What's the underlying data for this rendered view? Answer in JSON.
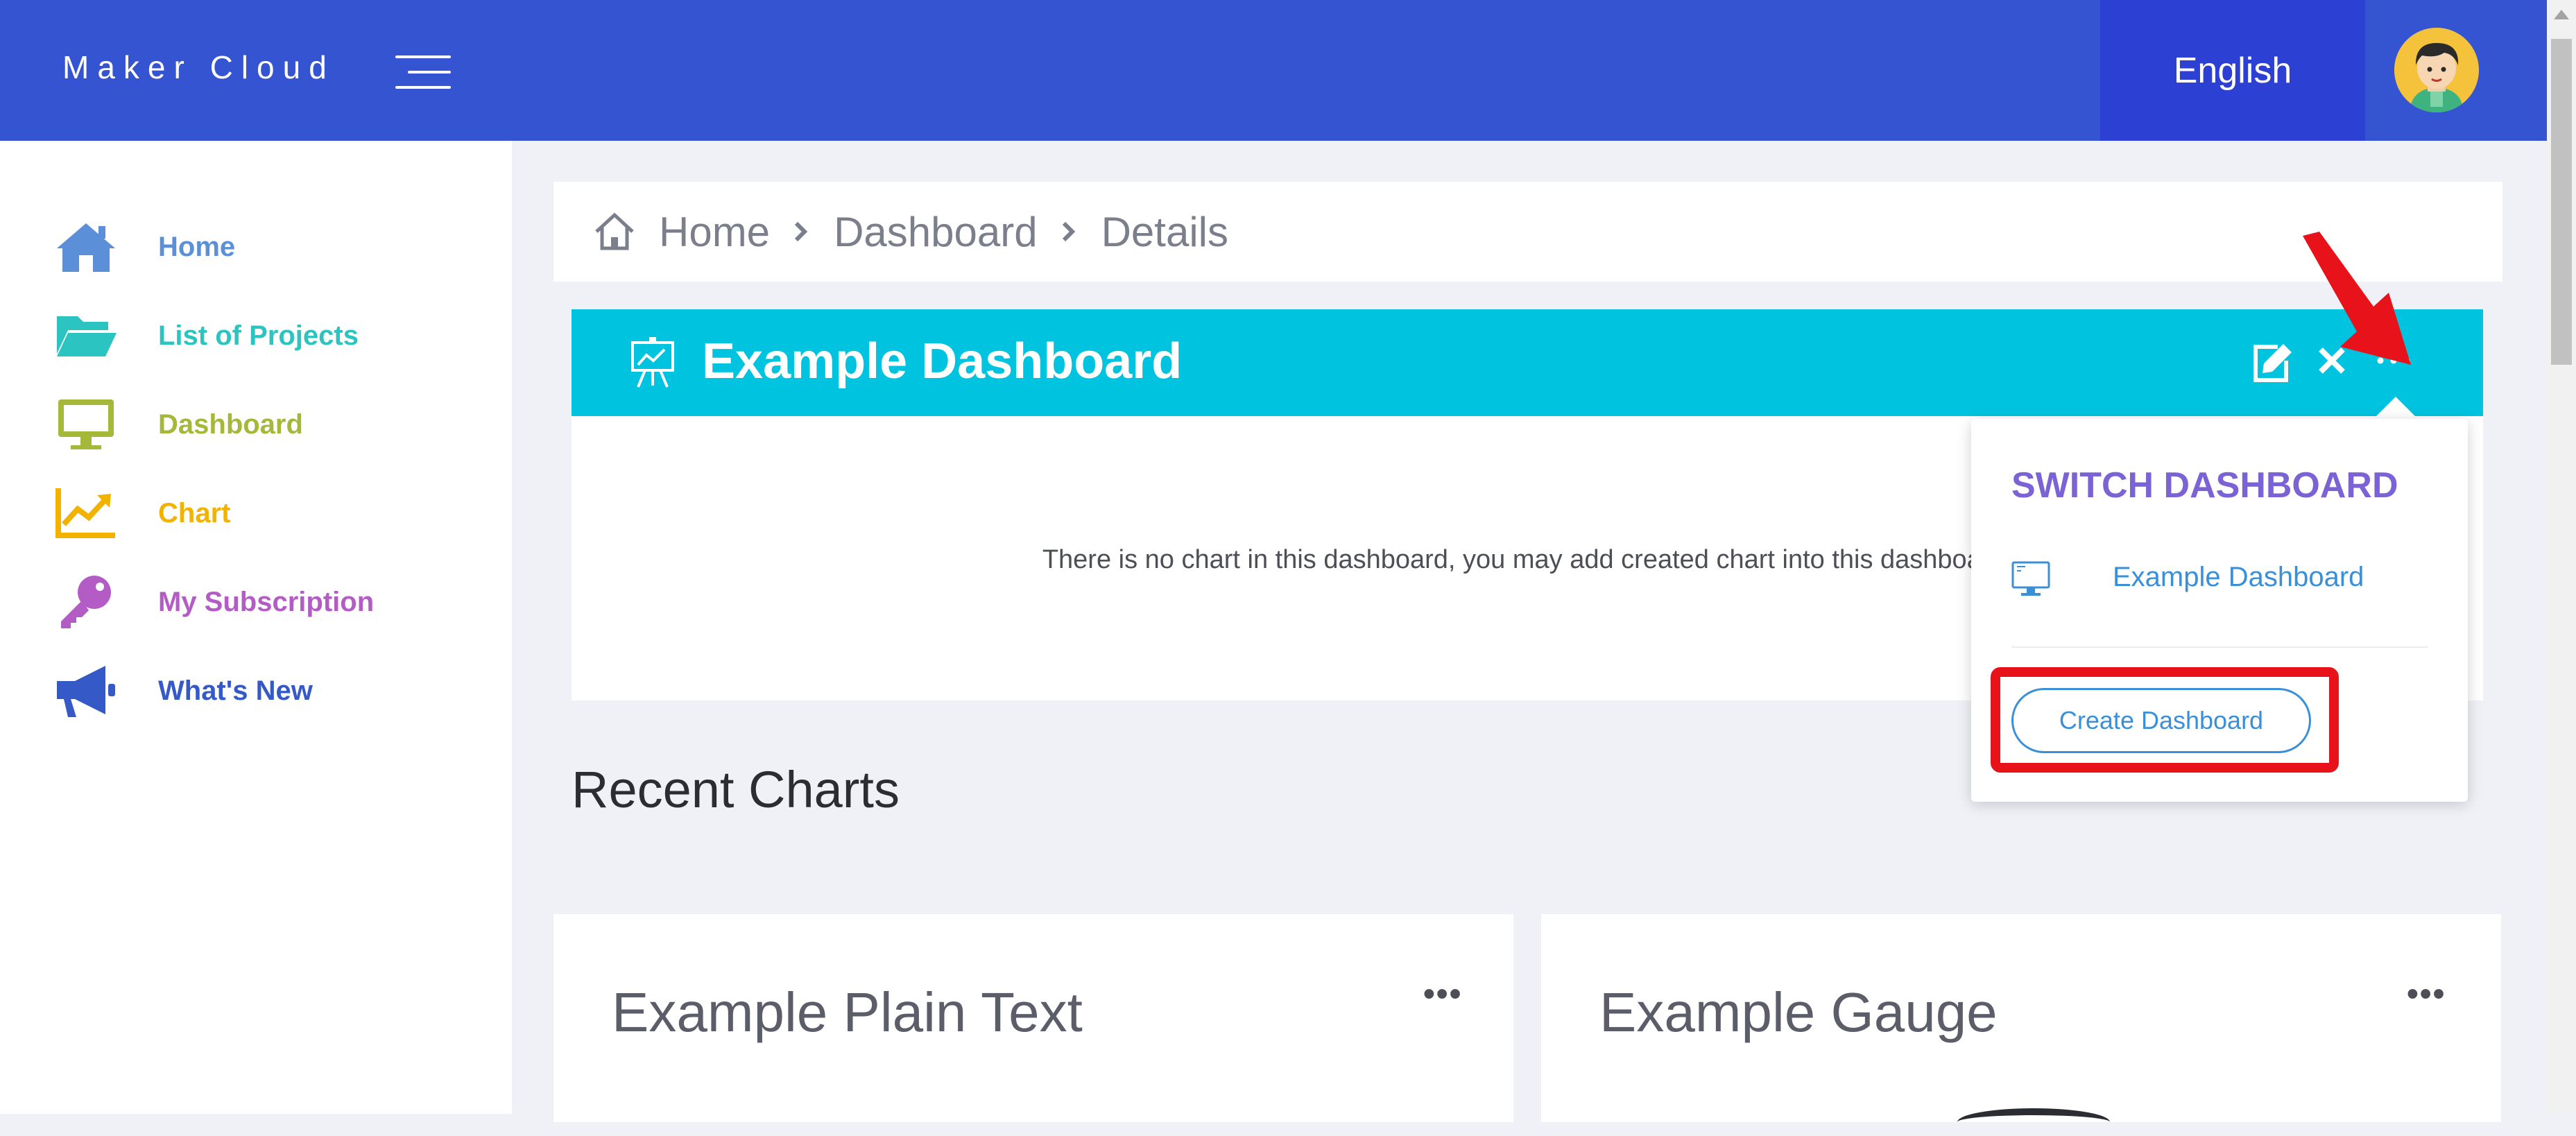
{
  "header": {
    "brand": "Maker Cloud",
    "language": "English"
  },
  "sidebar": {
    "items": [
      {
        "label": "Home",
        "color": "#5b8fd8"
      },
      {
        "label": "List of Projects",
        "color": "#2cc4c0"
      },
      {
        "label": "Dashboard",
        "color": "#a6b83a"
      },
      {
        "label": "Chart",
        "color": "#f2b200"
      },
      {
        "label": "My Subscription",
        "color": "#b35cc6"
      },
      {
        "label": "What's New",
        "color": "#3659c8"
      }
    ]
  },
  "breadcrumb": [
    "Home",
    "Dashboard",
    "Details"
  ],
  "dashboard": {
    "title": "Example Dashboard",
    "empty_message": "There is no chart in this dashboard, you may add created chart into this dashboard."
  },
  "recent": {
    "title": "Recent Charts",
    "cards": [
      {
        "title": "Example Plain Text",
        "menu": "•••"
      },
      {
        "title": "Example Gauge",
        "menu": "•••"
      }
    ]
  },
  "dropdown": {
    "heading": "SWITCH DASHBOARD",
    "items": [
      {
        "label": "Example Dashboard"
      }
    ],
    "create_label": "Create Dashboard"
  }
}
